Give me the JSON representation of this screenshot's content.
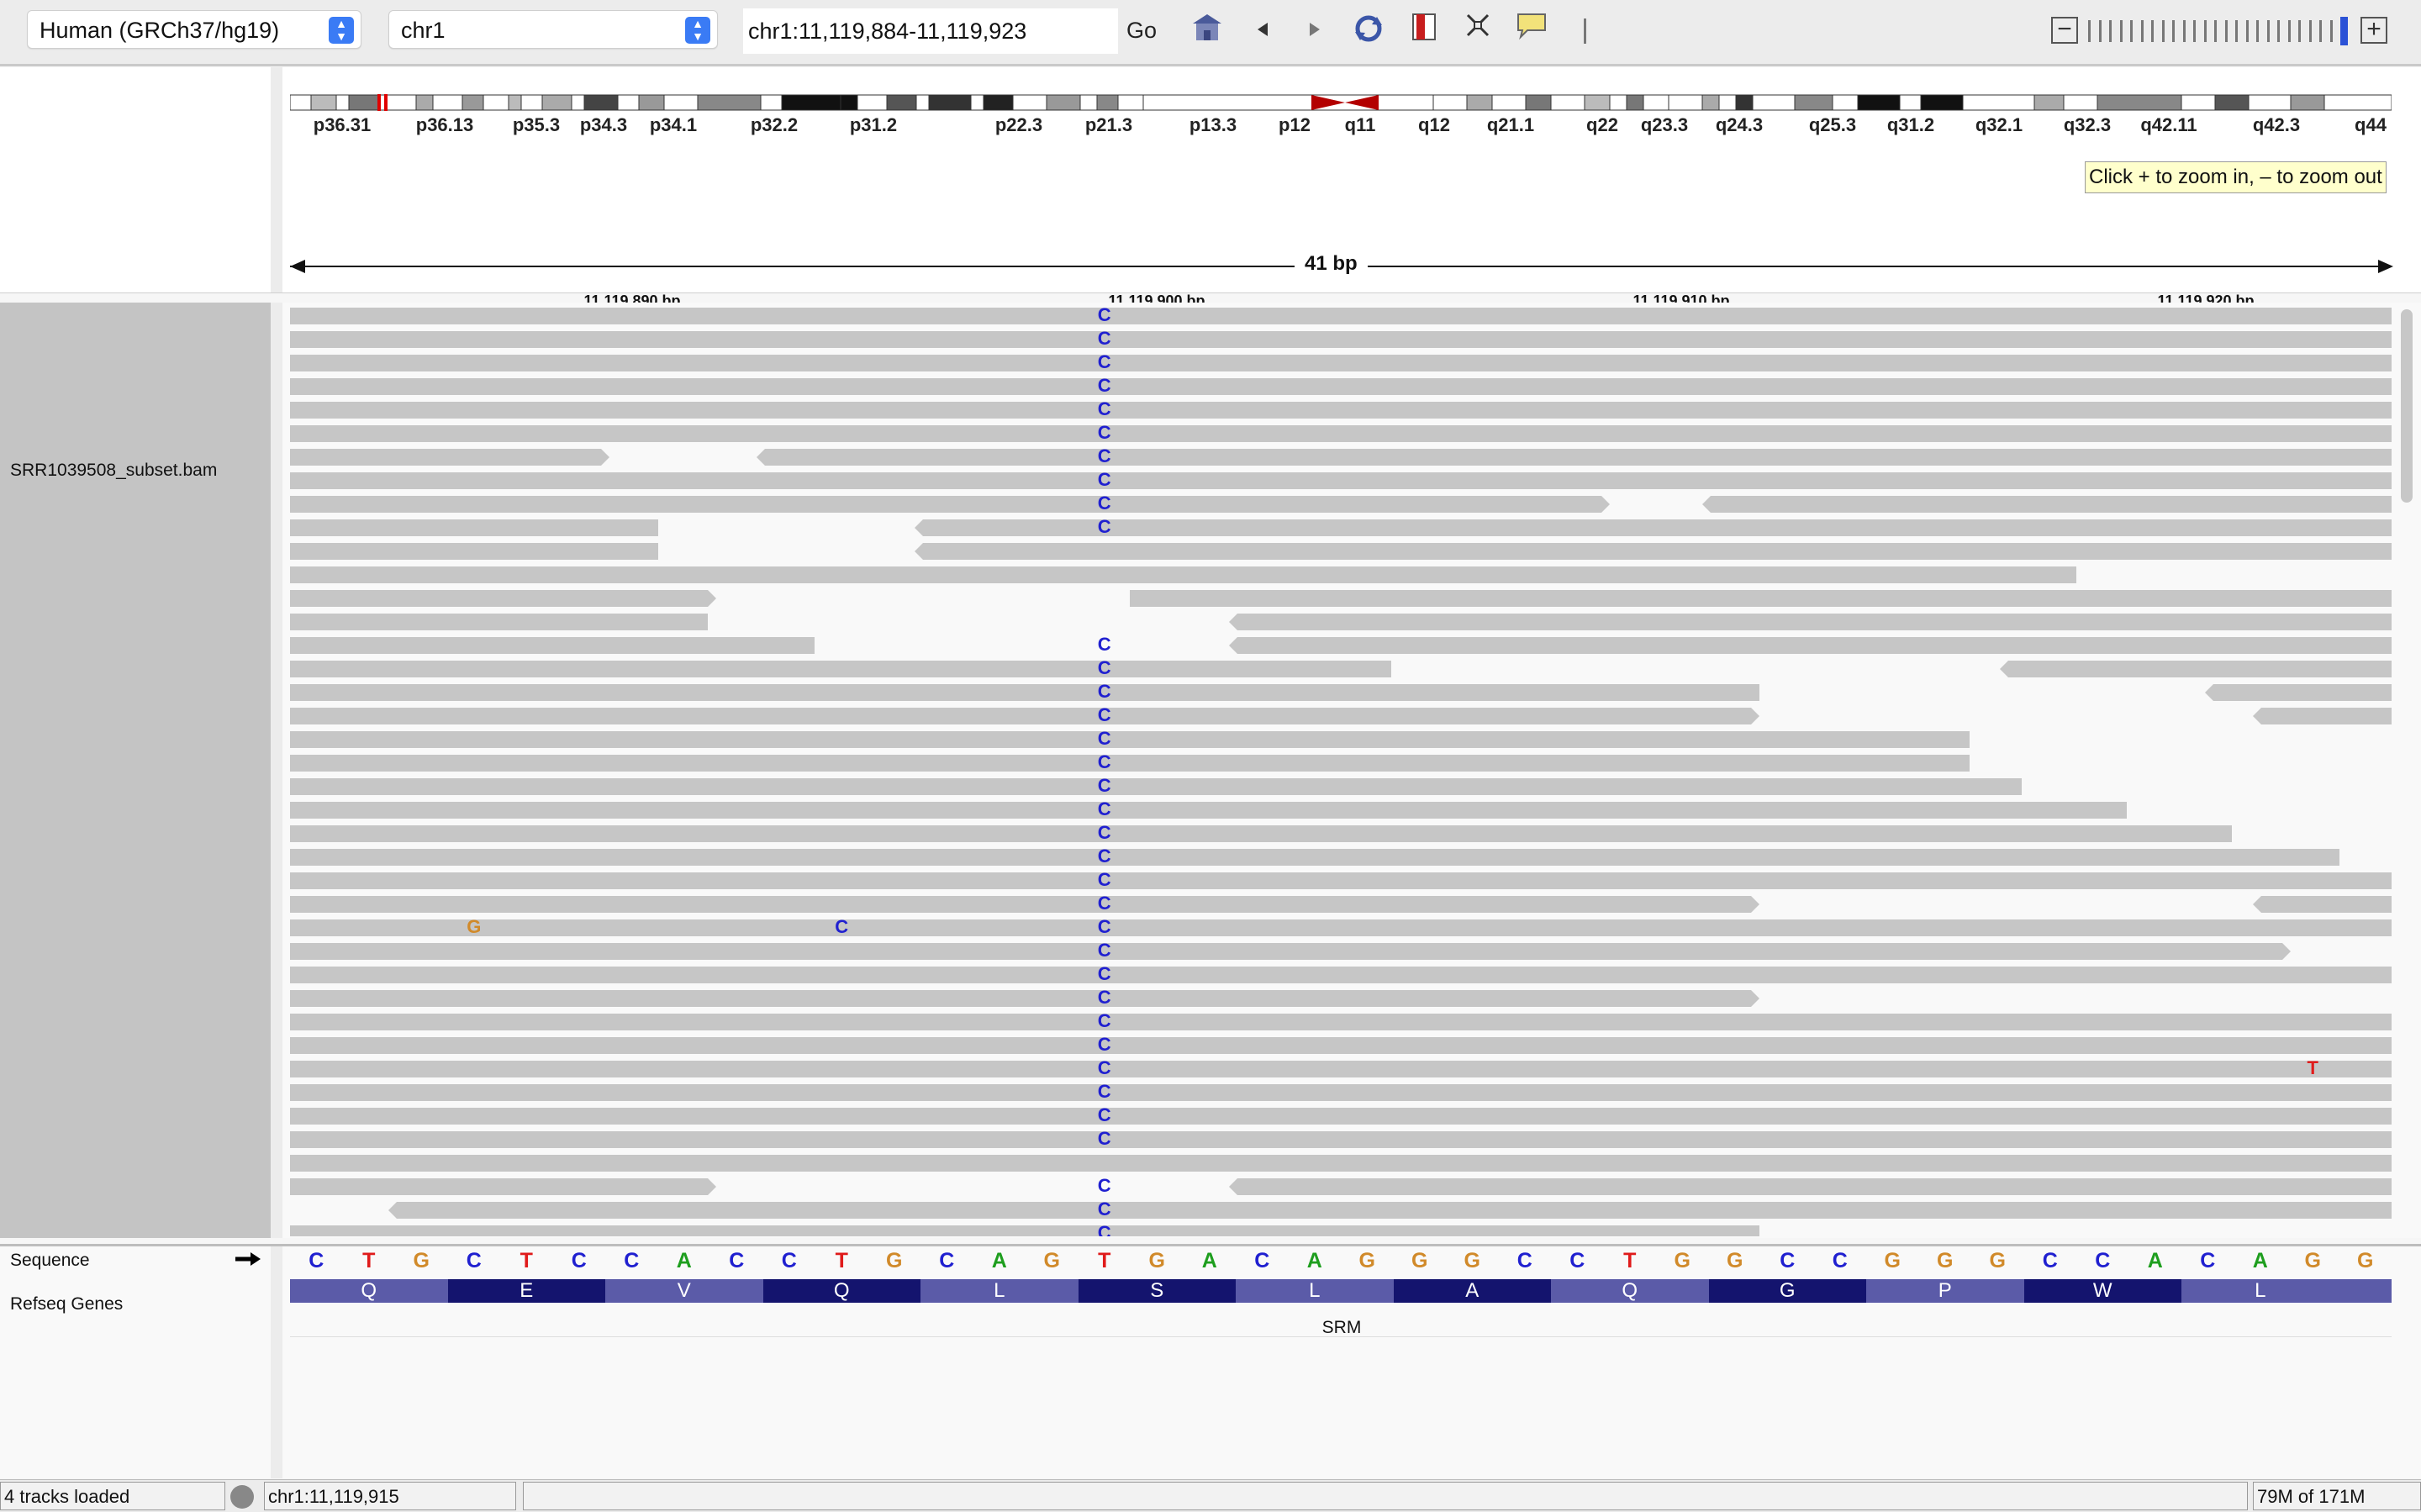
{
  "toolbar": {
    "genome": "Human (GRCh37/hg19)",
    "chromosome": "chr1",
    "locus": "chr1:11,119,884-11,119,923",
    "go_label": "Go",
    "zoom_out_label": "−",
    "zoom_in_label": "+"
  },
  "ideogram": {
    "bands": [
      "p36.31",
      "p36.13",
      "p35.3",
      "p34.3",
      "p34.1",
      "p32.2",
      "p31.2",
      "p22.3",
      "p21.3",
      "p13.3",
      "p12",
      "q11",
      "q12",
      "q21.1",
      "q22",
      "q23.3",
      "q24.3",
      "q25.3",
      "q31.2",
      "q32.1",
      "q32.3",
      "q42.11",
      "q42.3",
      "q44"
    ],
    "tooltip": "Click + to zoom in,  – to zoom out"
  },
  "ruler": {
    "span": "41 bp",
    "labels": [
      "11,119,890 bp",
      "11,119,900 bp",
      "11,119,910 bp",
      "11,119,920 bp"
    ]
  },
  "alignment_track": {
    "name": "SRR1039508_subset.bam",
    "mismatch_colors": {
      "C": "#2020d0",
      "G": "#d18a2a",
      "T": "#e01b1b",
      "A": "#1e9e1e"
    },
    "mismatches": [
      {
        "row": 0,
        "pos": 15,
        "base": "C"
      },
      {
        "row": 1,
        "pos": 15,
        "base": "C"
      },
      {
        "row": 2,
        "pos": 15,
        "base": "C"
      },
      {
        "row": 3,
        "pos": 15,
        "base": "C"
      },
      {
        "row": 4,
        "pos": 15,
        "base": "C"
      },
      {
        "row": 5,
        "pos": 15,
        "base": "C"
      },
      {
        "row": 6,
        "pos": 15,
        "base": "C"
      },
      {
        "row": 7,
        "pos": 15,
        "base": "C"
      },
      {
        "row": 8,
        "pos": 15,
        "base": "C"
      },
      {
        "row": 9,
        "pos": 15,
        "base": "C"
      },
      {
        "row": 14,
        "pos": 15,
        "base": "C"
      },
      {
        "row": 15,
        "pos": 15,
        "base": "C"
      },
      {
        "row": 16,
        "pos": 15,
        "base": "C"
      },
      {
        "row": 17,
        "pos": 15,
        "base": "C"
      },
      {
        "row": 18,
        "pos": 15,
        "base": "C"
      },
      {
        "row": 19,
        "pos": 15,
        "base": "C"
      },
      {
        "row": 20,
        "pos": 15,
        "base": "C"
      },
      {
        "row": 21,
        "pos": 15,
        "base": "C"
      },
      {
        "row": 22,
        "pos": 15,
        "base": "C"
      },
      {
        "row": 23,
        "pos": 15,
        "base": "C"
      },
      {
        "row": 24,
        "pos": 15,
        "base": "C"
      },
      {
        "row": 25,
        "pos": 15,
        "base": "C"
      },
      {
        "row": 26,
        "pos": 15,
        "base": "C"
      },
      {
        "row": 26,
        "pos": 3,
        "base": "G"
      },
      {
        "row": 26,
        "pos": 10,
        "base": "C"
      },
      {
        "row": 27,
        "pos": 15,
        "base": "C"
      },
      {
        "row": 28,
        "pos": 15,
        "base": "C"
      },
      {
        "row": 29,
        "pos": 15,
        "base": "C"
      },
      {
        "row": 30,
        "pos": 15,
        "base": "C"
      },
      {
        "row": 31,
        "pos": 15,
        "base": "C"
      },
      {
        "row": 32,
        "pos": 15,
        "base": "C"
      },
      {
        "row": 32,
        "pos": 38,
        "base": "T"
      },
      {
        "row": 33,
        "pos": 15,
        "base": "C"
      },
      {
        "row": 34,
        "pos": 15,
        "base": "C"
      },
      {
        "row": 35,
        "pos": 15,
        "base": "C"
      },
      {
        "row": 37,
        "pos": 15,
        "base": "C"
      },
      {
        "row": 38,
        "pos": 15,
        "base": "C"
      },
      {
        "row": 39,
        "pos": 15,
        "base": "C"
      }
    ]
  },
  "sequence_track": {
    "name": "Sequence",
    "bases": [
      "C",
      "T",
      "G",
      "C",
      "T",
      "C",
      "C",
      "A",
      "C",
      "C",
      "T",
      "G",
      "C",
      "A",
      "G",
      "T",
      "G",
      "A",
      "C",
      "A",
      "G",
      "G",
      "G",
      "C",
      "C",
      "T",
      "G",
      "G",
      "C",
      "C",
      "G",
      "G",
      "G",
      "C",
      "C",
      "A",
      "C",
      "A",
      "G",
      "G"
    ]
  },
  "gene_track": {
    "name": "Refseq Genes",
    "amino_acids": [
      "Q",
      "E",
      "V",
      "Q",
      "L",
      "S",
      "L",
      "A",
      "Q",
      "G",
      "P",
      "W",
      "L"
    ],
    "gene": "SRM"
  },
  "status": {
    "tracks": "4 tracks loaded",
    "position": "chr1:11,119,915",
    "memory": "79M of 171M"
  }
}
